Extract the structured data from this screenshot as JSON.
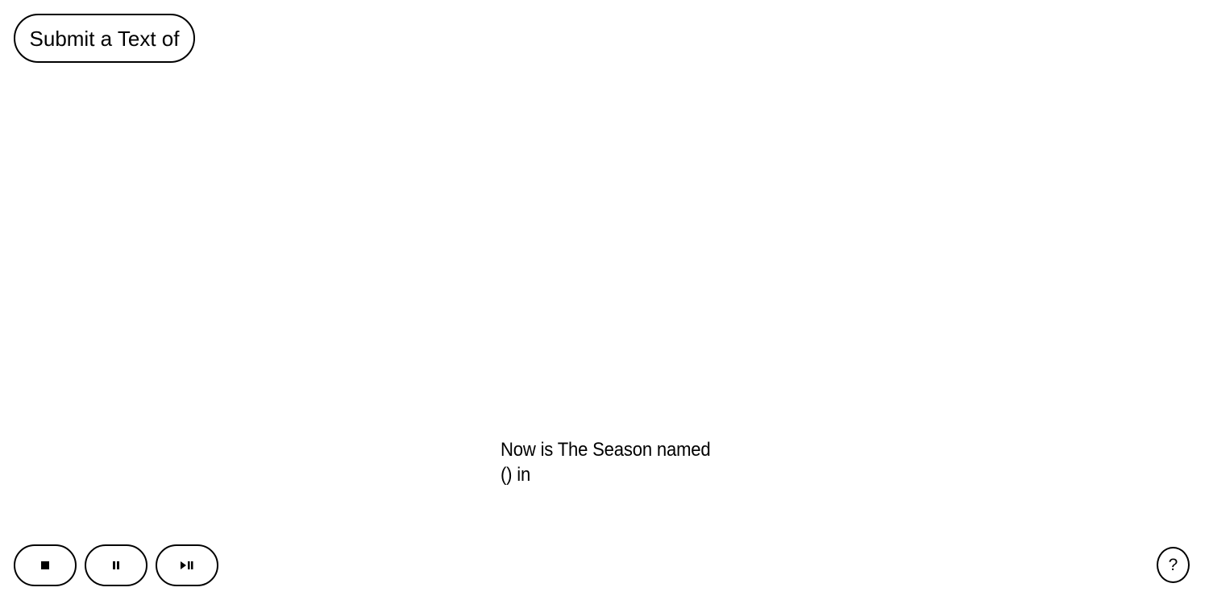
{
  "header": {
    "submit_label": "Submit a Text of"
  },
  "main": {
    "lines": [
      "Now is The Season named",
      "() in"
    ]
  },
  "controls": {
    "stop_icon": "stop-icon",
    "pause_icon": "pause-icon",
    "play_pause_icon": "play-pause-icon"
  },
  "help": {
    "label": "?"
  },
  "colors": {
    "background": "#ffffff",
    "foreground": "#000000"
  }
}
